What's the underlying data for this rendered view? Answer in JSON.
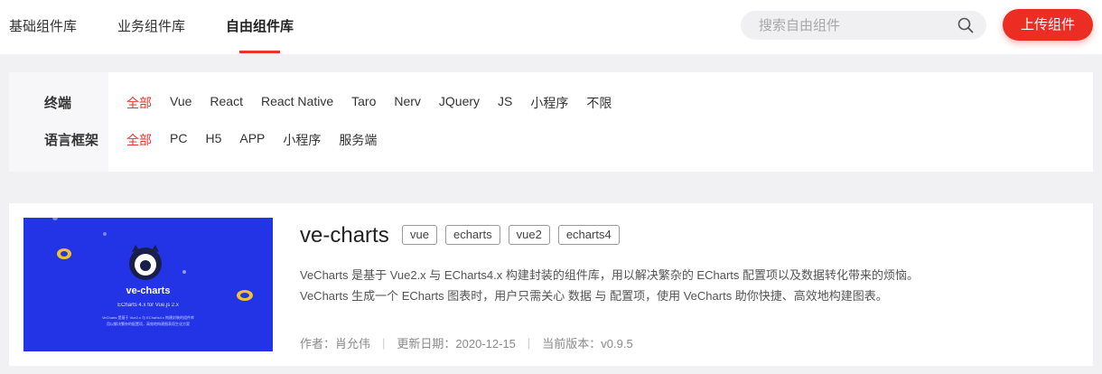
{
  "header": {
    "tabs": [
      {
        "label": "基础组件库"
      },
      {
        "label": "业务组件库"
      },
      {
        "label": "自由组件库"
      }
    ],
    "active_tab_index": 2,
    "search": {
      "placeholder": "搜索自由组件",
      "value": "",
      "icon": "search-icon"
    },
    "upload_button": "上传组件",
    "accent_color": "#ec2d23"
  },
  "filters": {
    "terminal": {
      "label": "终端",
      "options": [
        "全部",
        "Vue",
        "React",
        "React Native",
        "Taro",
        "Nerv",
        "JQuery",
        "JS",
        "小程序",
        "不限"
      ],
      "selected": "全部"
    },
    "language": {
      "label": "语言框架",
      "options": [
        "全部",
        "PC",
        "H5",
        "APP",
        "小程序",
        "服务端"
      ],
      "selected": "全部"
    }
  },
  "card": {
    "title": "ve-charts",
    "tags": [
      "vue",
      "echarts",
      "vue2",
      "echarts4"
    ],
    "description": [
      "VeCharts 是基于 Vue2.x 与 ECharts4.x 构建封装的组件库，用以解决繁杂的 ECharts 配置项以及数据转化带来的烦恼。",
      "VeCharts 生成一个 ECharts 图表时，用户只需关心 数据 与 配置项，使用 VeCharts 助你快捷、高效地构建图表。"
    ],
    "meta": {
      "author": "作者：肖允伟",
      "updated": "更新日期：2020-12-15",
      "version": "当前版本：v0.9.5"
    },
    "thumbnail": {
      "background": "#2334e6",
      "logo_text": "ve-charts",
      "subtitle": "ECharts 4.x for Vue.js 2.x",
      "small_line_1": "VeCharts 是基于 Vue2.x 与 ECharts4.x 构建封装的组件库",
      "small_line_2": "用以解决繁杂的配置项，高效地构建图表而生化方案"
    }
  }
}
